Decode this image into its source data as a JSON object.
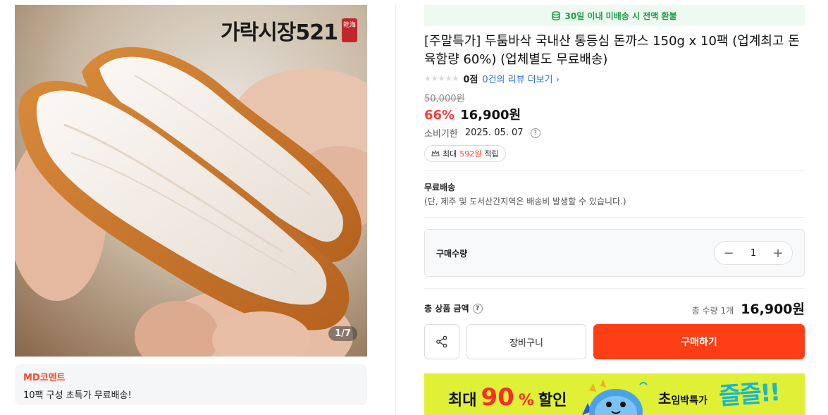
{
  "gallery": {
    "brand_text": "가락시장521",
    "seal_text": "乾海",
    "counter": "1/7"
  },
  "md_comment": {
    "title": "MD코멘트",
    "text": "10팩 구성 초특가 무료배송!"
  },
  "refund_banner": "30일 이내 미배송 시 전액 환불",
  "product": {
    "title": "[주말특가] 두툼바삭 국내산 통등심 돈까스 150g x 10팩 (업계최고 돈육함량 60%) (업체별도 무료배송)",
    "rating": {
      "stars": 0,
      "score": "0점",
      "review_link": "0건의 리뷰 더보기"
    },
    "original_price": "50,000원",
    "discount": "66%",
    "sale_price": "16,900원",
    "expiry_label": "소비기한",
    "expiry_value": "2025. 05. 07",
    "points": {
      "prefix": "최대",
      "value": "592원",
      "suffix": "적립"
    }
  },
  "shipping": {
    "title": "무료배송",
    "note": "(단, 제주 및 도서산간지역은 배송비 발생할 수 있습니다.)"
  },
  "quantity": {
    "label": "구매수량",
    "value": "1"
  },
  "total": {
    "label": "총 상품 금액",
    "qty_text": "총 수량 1개",
    "price": "16,900원"
  },
  "buttons": {
    "cart": "장바구니",
    "buy": "구매하기"
  },
  "promo": {
    "prefix": "최대",
    "number": "90",
    "percent": "%",
    "suffix": "할인",
    "right_big": "초",
    "right_small": "임박특가",
    "bang": "즐즐!!"
  },
  "colors": {
    "accent": "#ff3e15",
    "discount": "#ff3b3b",
    "link": "#2f6fe0",
    "refund_green": "#1e9a4a",
    "promo_bg": "#dff036"
  }
}
